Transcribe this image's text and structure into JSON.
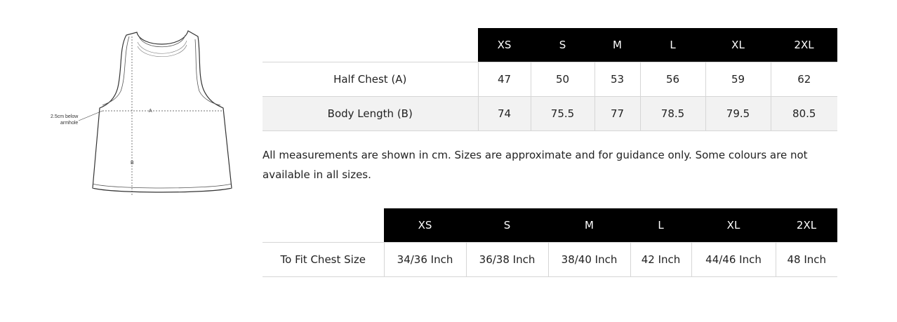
{
  "diagram": {
    "label_a": "A",
    "label_b": "B",
    "note_line1": "2.5cm below",
    "note_line2": "armhole"
  },
  "measurements_table": {
    "sizes": [
      "XS",
      "S",
      "M",
      "L",
      "XL",
      "2XL"
    ],
    "rows": [
      {
        "label": "Half Chest (A)",
        "values": [
          "47",
          "50",
          "53",
          "56",
          "59",
          "62"
        ]
      },
      {
        "label": "Body Length (B)",
        "values": [
          "74",
          "75.5",
          "77",
          "78.5",
          "79.5",
          "80.5"
        ]
      }
    ]
  },
  "note": "All measurements are shown in cm. Sizes are approximate and for guidance only. Some colours are not available in all sizes.",
  "fit_table": {
    "sizes": [
      "XS",
      "S",
      "M",
      "L",
      "XL",
      "2XL"
    ],
    "rows": [
      {
        "label": "To Fit Chest Size",
        "values": [
          "34/36 Inch",
          "36/38 Inch",
          "38/40 Inch",
          "42 Inch",
          "44/46 Inch",
          "48 Inch"
        ]
      }
    ]
  }
}
